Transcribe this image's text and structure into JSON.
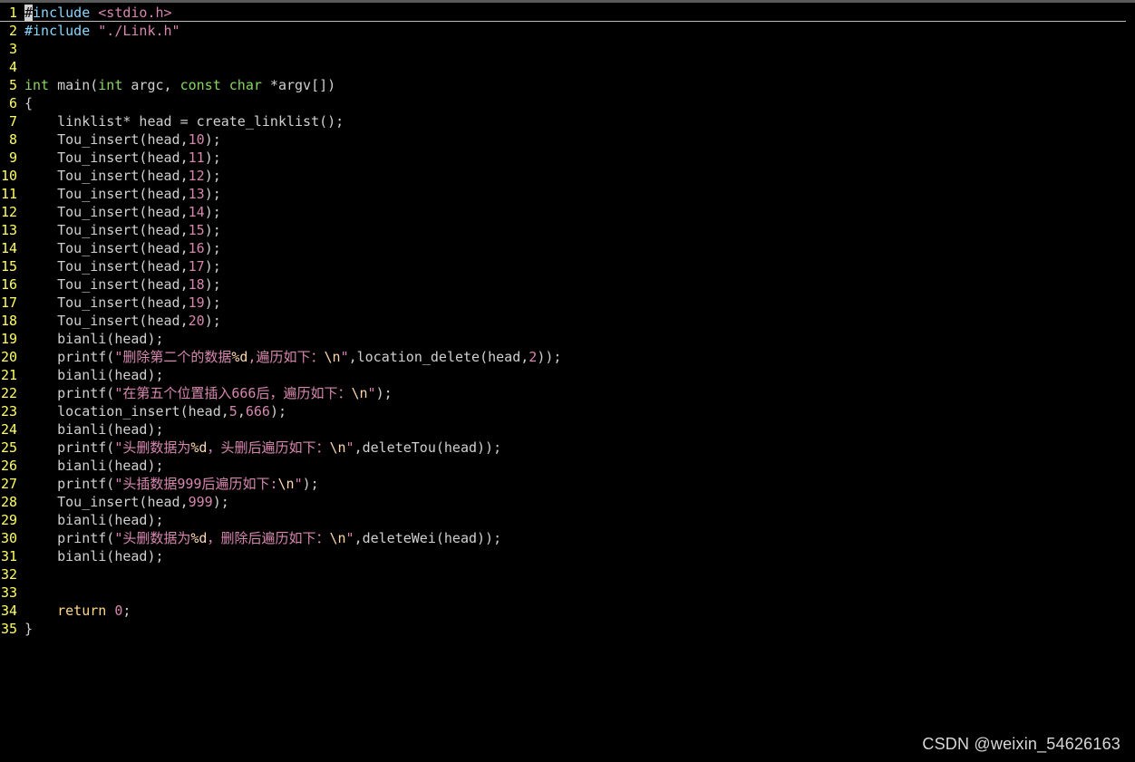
{
  "colors": {
    "background": "#000000",
    "line_number": "#ffff5f",
    "plain": "#d0d0d0",
    "preproc": "#87d7ff",
    "string": "#d787af",
    "type": "#87d75f",
    "keyword": "#ffd787",
    "number": "#d787af",
    "escape": "#ffd7af"
  },
  "editor": {
    "lines": [
      {
        "n": "1",
        "tokens": [
          {
            "t": "#",
            "c": "cursor"
          },
          {
            "t": "include ",
            "c": "pre"
          },
          {
            "t": "<stdio.h>",
            "c": "str"
          }
        ]
      },
      {
        "n": "2",
        "tokens": [
          {
            "t": "#include ",
            "c": "pre"
          },
          {
            "t": "\"./Link.h\"",
            "c": "str"
          }
        ]
      },
      {
        "n": "3",
        "tokens": []
      },
      {
        "n": "4",
        "tokens": []
      },
      {
        "n": "5",
        "tokens": [
          {
            "t": "int",
            "c": "type"
          },
          {
            "t": " main(",
            "c": "plain"
          },
          {
            "t": "int",
            "c": "type"
          },
          {
            "t": " argc, ",
            "c": "plain"
          },
          {
            "t": "const",
            "c": "type"
          },
          {
            "t": " ",
            "c": "plain"
          },
          {
            "t": "char",
            "c": "type"
          },
          {
            "t": " *argv[])",
            "c": "plain"
          }
        ]
      },
      {
        "n": "6",
        "tokens": [
          {
            "t": "{",
            "c": "plain"
          }
        ]
      },
      {
        "n": "7",
        "tokens": [
          {
            "t": "    linklist* head = create_linklist();",
            "c": "plain"
          }
        ]
      },
      {
        "n": "8",
        "tokens": [
          {
            "t": "    Tou_insert(head,",
            "c": "plain"
          },
          {
            "t": "10",
            "c": "num"
          },
          {
            "t": ");",
            "c": "plain"
          }
        ]
      },
      {
        "n": "9",
        "tokens": [
          {
            "t": "    Tou_insert(head,",
            "c": "plain"
          },
          {
            "t": "11",
            "c": "num"
          },
          {
            "t": ");",
            "c": "plain"
          }
        ]
      },
      {
        "n": "10",
        "tokens": [
          {
            "t": "    Tou_insert(head,",
            "c": "plain"
          },
          {
            "t": "12",
            "c": "num"
          },
          {
            "t": ");",
            "c": "plain"
          }
        ]
      },
      {
        "n": "11",
        "tokens": [
          {
            "t": "    Tou_insert(head,",
            "c": "plain"
          },
          {
            "t": "13",
            "c": "num"
          },
          {
            "t": ");",
            "c": "plain"
          }
        ]
      },
      {
        "n": "12",
        "tokens": [
          {
            "t": "    Tou_insert(head,",
            "c": "plain"
          },
          {
            "t": "14",
            "c": "num"
          },
          {
            "t": ");",
            "c": "plain"
          }
        ]
      },
      {
        "n": "13",
        "tokens": [
          {
            "t": "    Tou_insert(head,",
            "c": "plain"
          },
          {
            "t": "15",
            "c": "num"
          },
          {
            "t": ");",
            "c": "plain"
          }
        ]
      },
      {
        "n": "14",
        "tokens": [
          {
            "t": "    Tou_insert(head,",
            "c": "plain"
          },
          {
            "t": "16",
            "c": "num"
          },
          {
            "t": ");",
            "c": "plain"
          }
        ]
      },
      {
        "n": "15",
        "tokens": [
          {
            "t": "    Tou_insert(head,",
            "c": "plain"
          },
          {
            "t": "17",
            "c": "num"
          },
          {
            "t": ");",
            "c": "plain"
          }
        ]
      },
      {
        "n": "16",
        "tokens": [
          {
            "t": "    Tou_insert(head,",
            "c": "plain"
          },
          {
            "t": "18",
            "c": "num"
          },
          {
            "t": ");",
            "c": "plain"
          }
        ]
      },
      {
        "n": "17",
        "tokens": [
          {
            "t": "    Tou_insert(head,",
            "c": "plain"
          },
          {
            "t": "19",
            "c": "num"
          },
          {
            "t": ");",
            "c": "plain"
          }
        ]
      },
      {
        "n": "18",
        "tokens": [
          {
            "t": "    Tou_insert(head,",
            "c": "plain"
          },
          {
            "t": "20",
            "c": "num"
          },
          {
            "t": ");",
            "c": "plain"
          }
        ]
      },
      {
        "n": "19",
        "tokens": [
          {
            "t": "    bianli(head);",
            "c": "plain"
          }
        ]
      },
      {
        "n": "20",
        "tokens": [
          {
            "t": "    printf(",
            "c": "plain"
          },
          {
            "t": "\"删除第二个的数据",
            "c": "str"
          },
          {
            "t": "%d",
            "c": "esc"
          },
          {
            "t": ",遍历如下：",
            "c": "str"
          },
          {
            "t": "\\n",
            "c": "esc"
          },
          {
            "t": "\"",
            "c": "str"
          },
          {
            "t": ",location_delete(head,",
            "c": "plain"
          },
          {
            "t": "2",
            "c": "num"
          },
          {
            "t": "));",
            "c": "plain"
          }
        ]
      },
      {
        "n": "21",
        "tokens": [
          {
            "t": "    bianli(head);",
            "c": "plain"
          }
        ]
      },
      {
        "n": "22",
        "tokens": [
          {
            "t": "    printf(",
            "c": "plain"
          },
          {
            "t": "\"在第五个位置插入666后，遍历如下：",
            "c": "str"
          },
          {
            "t": "\\n",
            "c": "esc"
          },
          {
            "t": "\"",
            "c": "str"
          },
          {
            "t": ");",
            "c": "plain"
          }
        ]
      },
      {
        "n": "23",
        "tokens": [
          {
            "t": "    location_insert(head,",
            "c": "plain"
          },
          {
            "t": "5",
            "c": "num"
          },
          {
            "t": ",",
            "c": "plain"
          },
          {
            "t": "666",
            "c": "num"
          },
          {
            "t": ");",
            "c": "plain"
          }
        ]
      },
      {
        "n": "24",
        "tokens": [
          {
            "t": "    bianli(head);",
            "c": "plain"
          }
        ]
      },
      {
        "n": "25",
        "tokens": [
          {
            "t": "    printf(",
            "c": "plain"
          },
          {
            "t": "\"头删数据为",
            "c": "str"
          },
          {
            "t": "%d",
            "c": "esc"
          },
          {
            "t": "，头删后遍历如下：",
            "c": "str"
          },
          {
            "t": "\\n",
            "c": "esc"
          },
          {
            "t": "\"",
            "c": "str"
          },
          {
            "t": ",deleteTou(head));",
            "c": "plain"
          }
        ]
      },
      {
        "n": "26",
        "tokens": [
          {
            "t": "    bianli(head);",
            "c": "plain"
          }
        ]
      },
      {
        "n": "27",
        "tokens": [
          {
            "t": "    printf(",
            "c": "plain"
          },
          {
            "t": "\"头插数据999后遍历如下:",
            "c": "str"
          },
          {
            "t": "\\n",
            "c": "esc"
          },
          {
            "t": "\"",
            "c": "str"
          },
          {
            "t": ");",
            "c": "plain"
          }
        ]
      },
      {
        "n": "28",
        "tokens": [
          {
            "t": "    Tou_insert(head,",
            "c": "plain"
          },
          {
            "t": "999",
            "c": "num"
          },
          {
            "t": ");",
            "c": "plain"
          }
        ]
      },
      {
        "n": "29",
        "tokens": [
          {
            "t": "    bianli(head);",
            "c": "plain"
          }
        ]
      },
      {
        "n": "30",
        "tokens": [
          {
            "t": "    printf(",
            "c": "plain"
          },
          {
            "t": "\"头删数据为",
            "c": "str"
          },
          {
            "t": "%d",
            "c": "esc"
          },
          {
            "t": "，删除后遍历如下：",
            "c": "str"
          },
          {
            "t": "\\n",
            "c": "esc"
          },
          {
            "t": "\"",
            "c": "str"
          },
          {
            "t": ",deleteWei(head));",
            "c": "plain"
          }
        ]
      },
      {
        "n": "31",
        "tokens": [
          {
            "t": "    bianli(head);",
            "c": "plain"
          }
        ]
      },
      {
        "n": "32",
        "tokens": []
      },
      {
        "n": "33",
        "tokens": []
      },
      {
        "n": "34",
        "tokens": [
          {
            "t": "    ",
            "c": "plain"
          },
          {
            "t": "return",
            "c": "kw"
          },
          {
            "t": " ",
            "c": "plain"
          },
          {
            "t": "0",
            "c": "num"
          },
          {
            "t": ";",
            "c": "plain"
          }
        ]
      },
      {
        "n": "35",
        "tokens": [
          {
            "t": "}",
            "c": "plain"
          }
        ]
      }
    ]
  },
  "watermark": "CSDN @weixin_54626163"
}
